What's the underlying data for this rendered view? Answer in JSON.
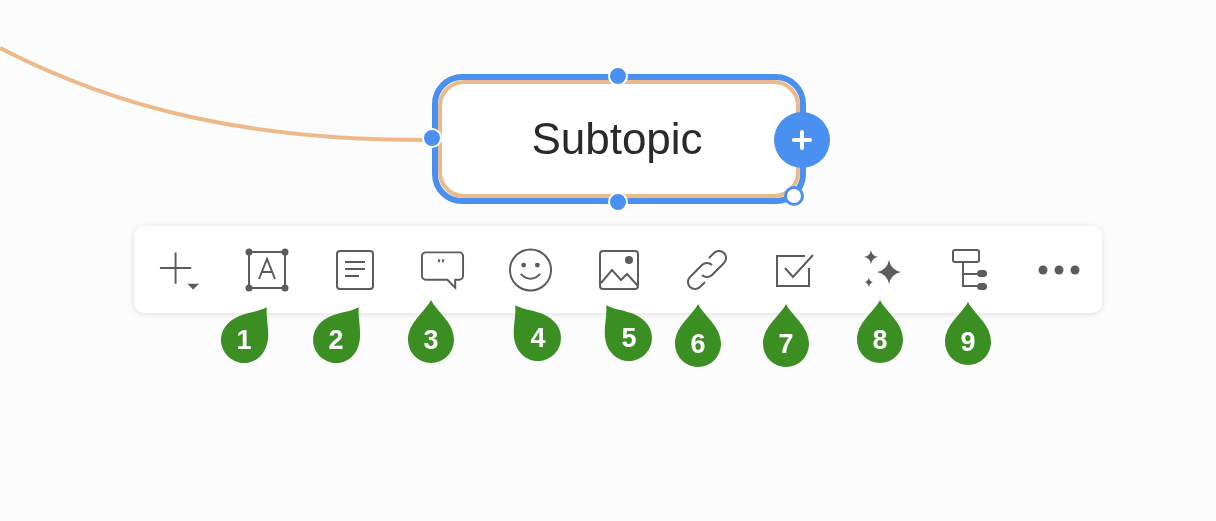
{
  "node": {
    "text": "Subtopic",
    "selected": true
  },
  "toolbar": [
    {
      "kind": "add"
    },
    {
      "kind": "text"
    },
    {
      "kind": "note"
    },
    {
      "kind": "comment"
    },
    {
      "kind": "emoji"
    },
    {
      "kind": "image"
    },
    {
      "kind": "link"
    },
    {
      "kind": "task"
    },
    {
      "kind": "ai"
    },
    {
      "kind": "structure"
    },
    {
      "kind": "more"
    }
  ],
  "markers": [
    {
      "label": "1"
    },
    {
      "label": "2"
    },
    {
      "label": "3"
    },
    {
      "label": "4"
    },
    {
      "label": "5"
    },
    {
      "label": "6"
    },
    {
      "label": "7"
    },
    {
      "label": "8"
    },
    {
      "label": "9"
    }
  ]
}
